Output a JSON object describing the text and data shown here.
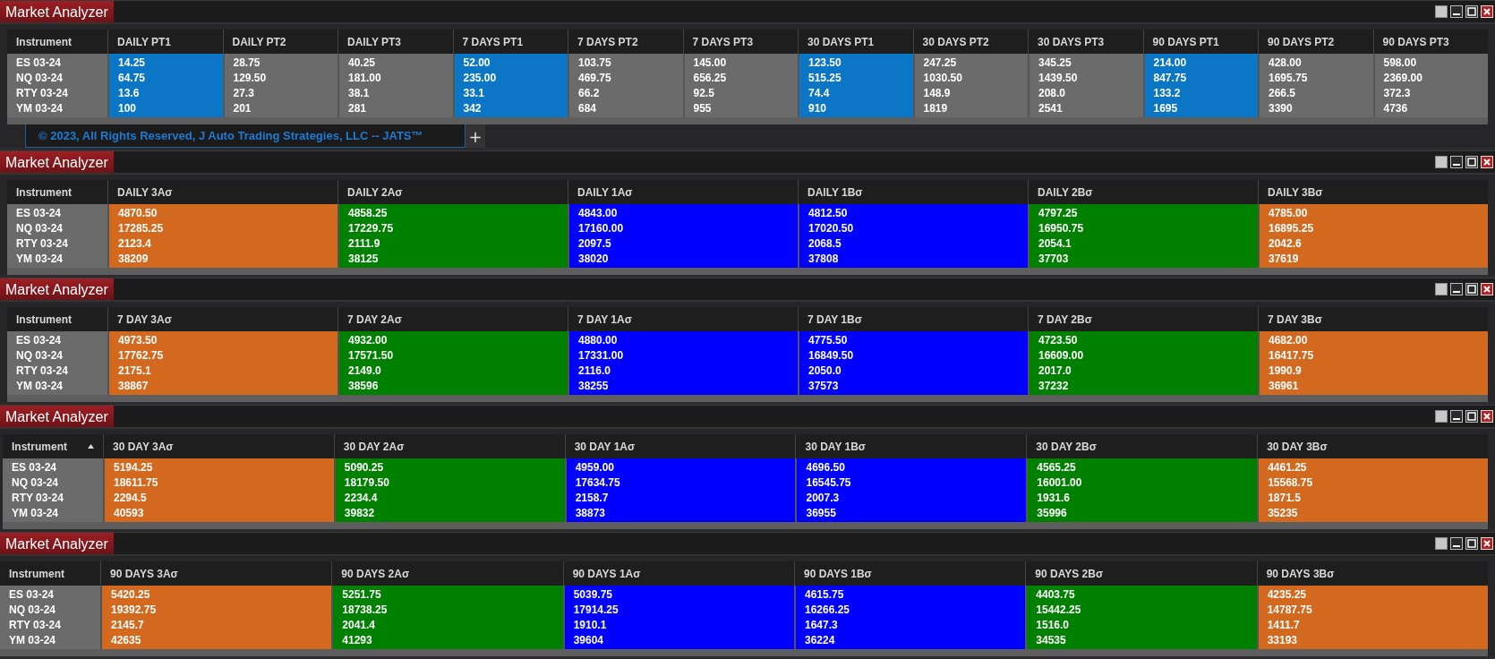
{
  "panels": [
    {
      "title": "Market Analyzer",
      "instrument_header": {
        "label": "Instrument",
        "sorted": false
      },
      "columns": [
        {
          "label": "DAILY PT1",
          "color": "#0b76c5",
          "values": [
            "14.25",
            "64.75",
            "13.6",
            "100"
          ]
        },
        {
          "label": "DAILY PT2",
          "color": "#6b6b6b",
          "values": [
            "28.75",
            "129.50",
            "27.3",
            "201"
          ]
        },
        {
          "label": "DAILY PT3",
          "color": "#6b6b6b",
          "values": [
            "40.25",
            "181.00",
            "38.1",
            "281"
          ]
        },
        {
          "label": "7 DAYS PT1",
          "color": "#0b76c5",
          "values": [
            "52.00",
            "235.00",
            "33.1",
            "342"
          ]
        },
        {
          "label": "7 DAYS PT2",
          "color": "#6b6b6b",
          "values": [
            "103.75",
            "469.75",
            "66.2",
            "684"
          ]
        },
        {
          "label": "7 DAYS PT3",
          "color": "#6b6b6b",
          "values": [
            "145.00",
            "656.25",
            "92.5",
            "955"
          ]
        },
        {
          "label": "30 DAYS PT1",
          "color": "#0b76c5",
          "values": [
            "123.50",
            "515.25",
            "74.4",
            "910"
          ]
        },
        {
          "label": "30 DAYS PT2",
          "color": "#6b6b6b",
          "values": [
            "247.25",
            "1030.50",
            "148.9",
            "1819"
          ]
        },
        {
          "label": "30 DAYS PT3",
          "color": "#6b6b6b",
          "values": [
            "345.25",
            "1439.50",
            "208.0",
            "2541"
          ]
        },
        {
          "label": "90 DAYS PT1",
          "color": "#0b76c5",
          "values": [
            "214.00",
            "847.75",
            "133.2",
            "1695"
          ]
        },
        {
          "label": "90 DAYS PT2",
          "color": "#6b6b6b",
          "values": [
            "428.00",
            "1695.75",
            "266.5",
            "3390"
          ]
        },
        {
          "label": "90 DAYS PT3",
          "color": "#6b6b6b",
          "values": [
            "598.00",
            "2369.00",
            "372.3",
            "4736"
          ]
        }
      ],
      "instruments": [
        "ES 03-24",
        "NQ 03-24",
        "RTY 03-24",
        "YM 03-24"
      ],
      "footer": {
        "tab": "© 2023, All Rights Reserved, J Auto Trading Strategies, LLC -- JATS™",
        "add_button": "+"
      }
    },
    {
      "title": "Market Analyzer",
      "instrument_header": {
        "label": "Instrument",
        "sorted": false
      },
      "columns": [
        {
          "label": "DAILY 3Aσ",
          "color": "#d2691e",
          "values": [
            "4870.50",
            "17285.25",
            "2123.4",
            "38209"
          ]
        },
        {
          "label": "DAILY 2Aσ",
          "color": "#008000",
          "values": [
            "4858.25",
            "17229.75",
            "2111.9",
            "38125"
          ]
        },
        {
          "label": "DAILY 1Aσ",
          "color": "#0000ff",
          "values": [
            "4843.00",
            "17160.00",
            "2097.5",
            "38020"
          ]
        },
        {
          "label": "DAILY 1Bσ",
          "color": "#0000ff",
          "values": [
            "4812.50",
            "17020.50",
            "2068.5",
            "37808"
          ]
        },
        {
          "label": "DAILY 2Bσ",
          "color": "#008000",
          "values": [
            "4797.25",
            "16950.75",
            "2054.1",
            "37703"
          ]
        },
        {
          "label": "DAILY 3Bσ",
          "color": "#d2691e",
          "values": [
            "4785.00",
            "16895.25",
            "2042.6",
            "37619"
          ]
        }
      ],
      "instruments": [
        "ES 03-24",
        "NQ 03-24",
        "RTY 03-24",
        "YM 03-24"
      ]
    },
    {
      "title": "Market Analyzer",
      "instrument_header": {
        "label": "Instrument",
        "sorted": false
      },
      "columns": [
        {
          "label": "7 DAY 3Aσ",
          "color": "#d2691e",
          "values": [
            "4973.50",
            "17762.75",
            "2175.1",
            "38867"
          ]
        },
        {
          "label": "7 DAY 2Aσ",
          "color": "#008000",
          "values": [
            "4932.00",
            "17571.50",
            "2149.0",
            "38596"
          ]
        },
        {
          "label": "7 DAY 1Aσ",
          "color": "#0000ff",
          "values": [
            "4880.00",
            "17331.00",
            "2116.0",
            "38255"
          ]
        },
        {
          "label": "7 DAY 1Bσ",
          "color": "#0000ff",
          "values": [
            "4775.50",
            "16849.50",
            "2050.0",
            "37573"
          ]
        },
        {
          "label": "7 DAY 2Bσ",
          "color": "#008000",
          "values": [
            "4723.50",
            "16609.00",
            "2017.0",
            "37232"
          ]
        },
        {
          "label": "7 DAY 3Bσ",
          "color": "#d2691e",
          "values": [
            "4682.00",
            "16417.75",
            "1990.9",
            "36961"
          ]
        }
      ],
      "instruments": [
        "ES 03-24",
        "NQ 03-24",
        "RTY 03-24",
        "YM 03-24"
      ]
    },
    {
      "title": "Market Analyzer",
      "instrument_header": {
        "label": "Instrument",
        "sorted": true
      },
      "columns": [
        {
          "label": "30 DAY 3Aσ",
          "color": "#d2691e",
          "values": [
            "5194.25",
            "18611.75",
            "2294.5",
            "40593"
          ]
        },
        {
          "label": "30 DAY 2Aσ",
          "color": "#008000",
          "values": [
            "5090.25",
            "18179.50",
            "2234.4",
            "39832"
          ]
        },
        {
          "label": "30 DAY 1Aσ",
          "color": "#0000ff",
          "values": [
            "4959.00",
            "17634.75",
            "2158.7",
            "38873"
          ]
        },
        {
          "label": "30 DAY 1Bσ",
          "color": "#0000ff",
          "values": [
            "4696.50",
            "16545.75",
            "2007.3",
            "36955"
          ]
        },
        {
          "label": "30 DAY 2Bσ",
          "color": "#008000",
          "values": [
            "4565.25",
            "16001.00",
            "1931.6",
            "35996"
          ]
        },
        {
          "label": "30 DAY 3Bσ",
          "color": "#d2691e",
          "values": [
            "4461.25",
            "15568.75",
            "1871.5",
            "35235"
          ]
        }
      ],
      "instruments": [
        "ES 03-24",
        "NQ 03-24",
        "RTY 03-24",
        "YM 03-24"
      ]
    },
    {
      "title": "Market Analyzer",
      "instrument_header": {
        "label": "Instrument",
        "sorted": false
      },
      "columns": [
        {
          "label": "90 DAYS 3Aσ",
          "color": "#d2691e",
          "values": [
            "5420.25",
            "19392.75",
            "2145.7",
            "42635"
          ]
        },
        {
          "label": "90 DAYS 2Aσ",
          "color": "#008000",
          "values": [
            "5251.75",
            "18738.25",
            "2041.4",
            "41293"
          ]
        },
        {
          "label": "90 DAYS 1Aσ",
          "color": "#0000ff",
          "values": [
            "5039.75",
            "17914.25",
            "1910.1",
            "39604"
          ]
        },
        {
          "label": "90 DAYS 1Bσ",
          "color": "#0000ff",
          "values": [
            "4615.75",
            "16266.25",
            "1647.3",
            "36224"
          ]
        },
        {
          "label": "90 DAYS 2Bσ",
          "color": "#008000",
          "values": [
            "4403.75",
            "15442.25",
            "1516.0",
            "34535"
          ]
        },
        {
          "label": "90 DAYS 3Bσ",
          "color": "#d2691e",
          "values": [
            "4235.25",
            "14787.75",
            "1411.7",
            "33193"
          ]
        }
      ],
      "instruments": [
        "ES 03-24",
        "NQ 03-24",
        "RTY 03-24",
        "YM 03-24"
      ]
    }
  ]
}
